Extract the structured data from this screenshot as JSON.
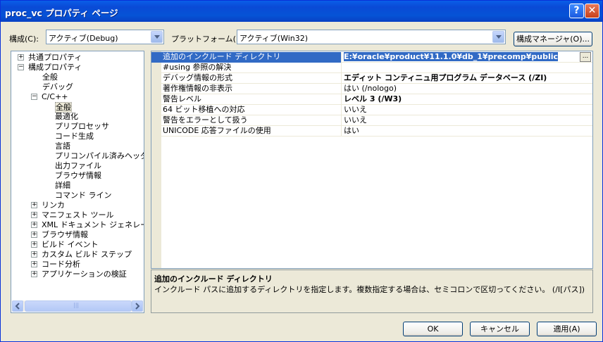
{
  "window": {
    "title": "proc_vc プロパティ ページ",
    "help_glyph": "?",
    "close_glyph": "✕"
  },
  "toolbar": {
    "config_label": "構成(C):",
    "config_value": "アクティブ(Debug)",
    "platform_label": "プラットフォーム(P):",
    "platform_value": "アクティブ(Win32)",
    "config_manager_button": "構成マネージャ(O)..."
  },
  "tree": {
    "items": [
      {
        "label": "共通プロパティ",
        "expander": "+"
      },
      {
        "label": "構成プロパティ",
        "expander": "−"
      },
      {
        "label": "全般"
      },
      {
        "label": "デバッグ"
      },
      {
        "label": "C/C++",
        "expander": "−"
      },
      {
        "label": "全般"
      },
      {
        "label": "最適化"
      },
      {
        "label": "プリプロセッサ"
      },
      {
        "label": "コード生成"
      },
      {
        "label": "言語"
      },
      {
        "label": "プリコンパイル済みヘッダー"
      },
      {
        "label": "出力ファイル"
      },
      {
        "label": "ブラウザ情報"
      },
      {
        "label": "詳細"
      },
      {
        "label": "コマンド ライン"
      },
      {
        "label": "リンカ",
        "expander": "+"
      },
      {
        "label": "マニフェスト ツール",
        "expander": "+"
      },
      {
        "label": "XML ドキュメント ジェネレータ",
        "expander": "+"
      },
      {
        "label": "ブラウザ情報",
        "expander": "+"
      },
      {
        "label": "ビルド イベント",
        "expander": "+"
      },
      {
        "label": "カスタム ビルド ステップ",
        "expander": "+"
      },
      {
        "label": "コード分析",
        "expander": "+"
      },
      {
        "label": "アプリケーションの検証",
        "expander": "+"
      }
    ],
    "scroll_grip": "|||"
  },
  "properties": {
    "rows": [
      {
        "name": "追加のインクルード ディレクトリ",
        "value": "E:¥oracle¥product¥11.1.0¥db_1¥precomp¥public"
      },
      {
        "name": "#using 参照の解決",
        "value": ""
      },
      {
        "name": "デバッグ情報の形式",
        "value": "エディット コンティニュ用プログラム データベース (/ZI)"
      },
      {
        "name": "著作権情報の非表示",
        "value": "はい (/nologo)"
      },
      {
        "name": "警告レベル",
        "value": "レベル 3 (/W3)"
      },
      {
        "name": "64 ビット移植への対応",
        "value": "いいえ"
      },
      {
        "name": "警告をエラーとして扱う",
        "value": "いいえ"
      },
      {
        "name": "UNICODE 応答ファイルの使用",
        "value": "はい"
      }
    ],
    "ellipsis_label": "..."
  },
  "description": {
    "title": "追加のインクルード ディレクトリ",
    "text": "インクルード パスに追加するディレクトリを指定します。複数指定する場合は、セミコロンで区切ってください。    (/I[パス])"
  },
  "buttons": {
    "ok": "OK",
    "cancel": "キャンセル",
    "apply": "適用(A)"
  }
}
